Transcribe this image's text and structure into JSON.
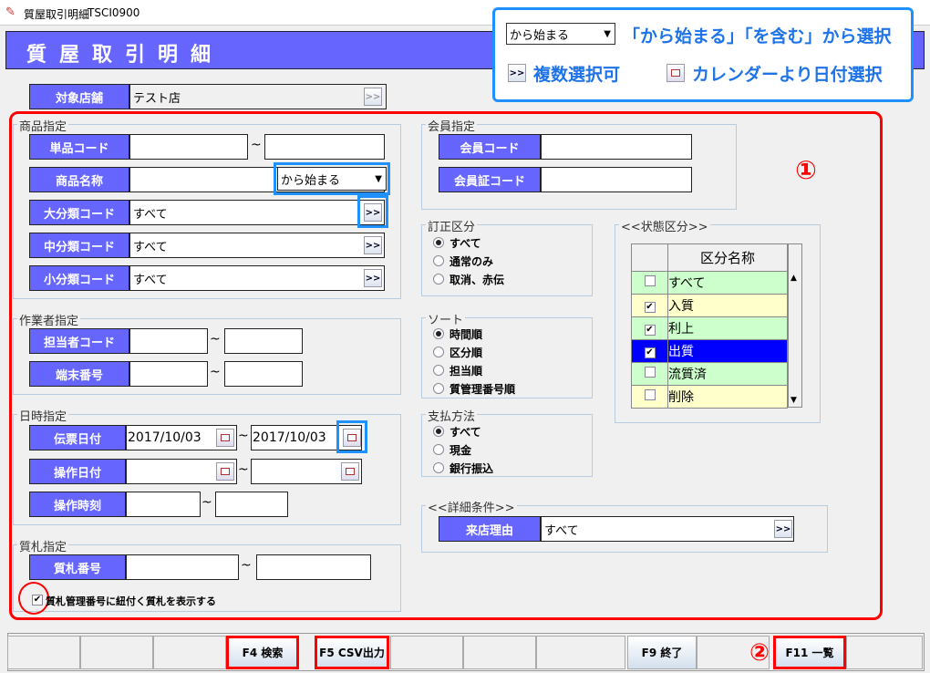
{
  "window": {
    "title": "質屋取引明細",
    "code": "TSCI0900"
  },
  "header": {
    "title": "質屋取引明細"
  },
  "store": {
    "label": "対象店舗",
    "value": "テスト店",
    "btn": ">>"
  },
  "product": {
    "group": "商品指定",
    "item_code": {
      "label": "単品コード",
      "from": "",
      "to": ""
    },
    "name": {
      "label": "商品名称",
      "value": "",
      "match": "から始まる"
    },
    "large": {
      "label": "大分類コード",
      "value": "すべて"
    },
    "middle": {
      "label": "中分類コード",
      "value": "すべて"
    },
    "small": {
      "label": "小分類コード",
      "value": "すべて"
    }
  },
  "worker": {
    "group": "作業者指定",
    "staff": {
      "label": "担当者コード"
    },
    "terminal": {
      "label": "端末番号"
    }
  },
  "date": {
    "group": "日時指定",
    "slip": {
      "label": "伝票日付",
      "from": "2017/10/03",
      "to": "2017/10/03"
    },
    "op_date": {
      "label": "操作日付"
    },
    "op_time": {
      "label": "操作時刻"
    }
  },
  "ticket": {
    "group": "質札指定",
    "number": {
      "label": "質札番号"
    },
    "checkbox": "質札管理番号に紐付く質札を表示する",
    "checked": true
  },
  "member": {
    "group": "会員指定",
    "code": {
      "label": "会員コード"
    },
    "card": {
      "label": "会員証コード"
    }
  },
  "correction": {
    "group": "訂正区分",
    "options": [
      "すべて",
      "通常のみ",
      "取消、赤伝"
    ],
    "selected": 0
  },
  "sort": {
    "group": "ソート",
    "options": [
      "時間順",
      "区分順",
      "担当順",
      "質管理番号順"
    ],
    "selected": 0
  },
  "payment": {
    "group": "支払方法",
    "options": [
      "すべて",
      "現金",
      "銀行振込"
    ],
    "selected": 0
  },
  "status": {
    "group": "<<状態区分>>",
    "header": "区分名称",
    "rows": [
      {
        "name": "すべて",
        "checked": false,
        "color": "#ccffcc"
      },
      {
        "name": "入質",
        "checked": true,
        "color": "#ffffcc"
      },
      {
        "name": "利上",
        "checked": true,
        "color": "#ccffcc"
      },
      {
        "name": "出質",
        "checked": true,
        "color": "#0000ff"
      },
      {
        "name": "流質済",
        "checked": false,
        "color": "#ccffcc"
      },
      {
        "name": "削除",
        "checked": false,
        "color": "#ffffcc"
      }
    ]
  },
  "detail": {
    "group": "<<詳細条件>>",
    "reason": {
      "label": "来店理由",
      "value": "すべて"
    }
  },
  "legend": {
    "combo": "から始まる",
    "combo_text": "「から始まる」「を含む」から選択",
    "multi_btn": ">>",
    "multi_text": "複数選択可",
    "cal_text": "カレンダーより日付選択"
  },
  "annotations": {
    "one": "①",
    "two": "②"
  },
  "footer": [
    "",
    "",
    "",
    "F4 検索",
    "F5 CSV出力",
    "",
    "",
    "",
    "F9 終了",
    "",
    "F11 一覧",
    ""
  ]
}
